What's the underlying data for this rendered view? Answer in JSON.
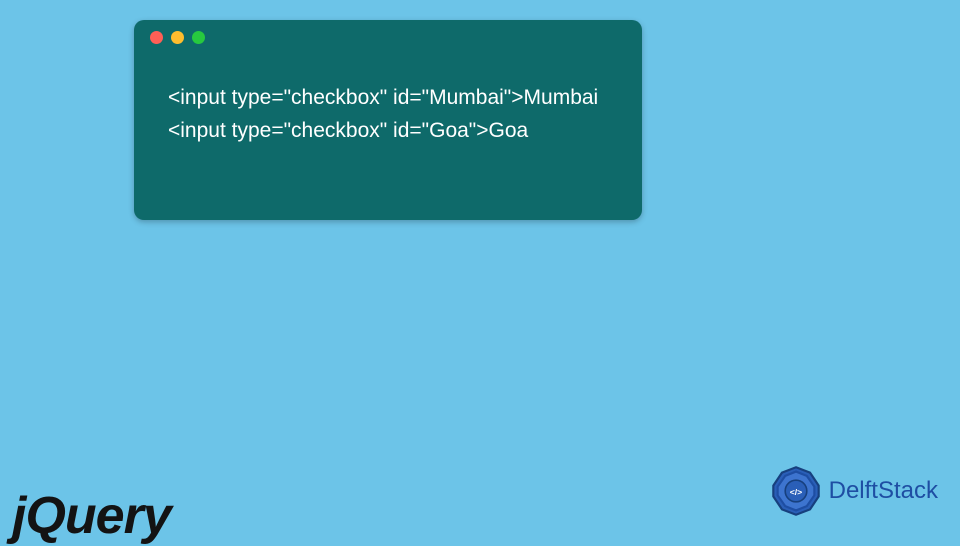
{
  "code": {
    "lines": [
      "<input type=\"checkbox\" id=\"Mumbai\">Mumbai",
      "<input type=\"checkbox\" id=\"Goa\">Goa"
    ]
  },
  "logos": {
    "jquery": "jQuery",
    "delftstack": "DelftStack"
  },
  "window": {
    "dots": [
      "red",
      "yellow",
      "green"
    ]
  }
}
